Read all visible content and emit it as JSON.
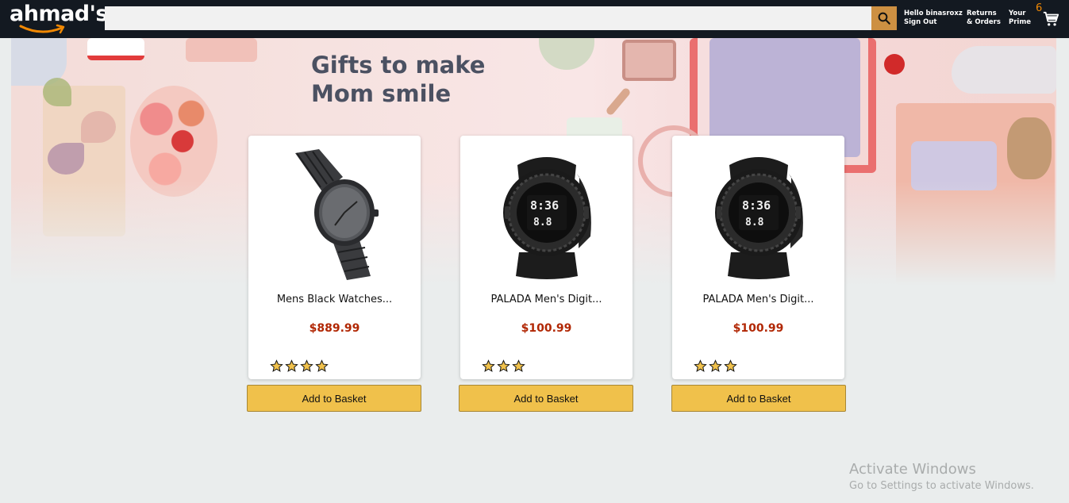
{
  "header": {
    "logo_text": "ahmad's",
    "search": {
      "value": "",
      "placeholder": ""
    },
    "greeting_line1": "Hello binasroxz",
    "greeting_line2": "Sign Out",
    "returns_line1": "Returns",
    "returns_line2": "& Orders",
    "prime_line1": "Your",
    "prime_line2": "Prime",
    "basket_count": "6",
    "icons": {
      "search": "search-icon",
      "cart": "cart-icon"
    },
    "colors": {
      "bar": "#131921",
      "search_button": "#cd9042",
      "basket_count": "#f08804"
    }
  },
  "hero": {
    "title_line1": "Gifts to make",
    "title_line2": "Mom smile"
  },
  "products": [
    {
      "title": "Mens Black Watches...",
      "price": "$889.99",
      "rating": 4,
      "button_label": "Add to Basket",
      "image": "black-analog-watch"
    },
    {
      "title": "PALADA Men's Digit...",
      "price": "$100.99",
      "rating": 3,
      "button_label": "Add to Basket",
      "image": "digital-sport-watch"
    },
    {
      "title": "PALADA Men's Digit...",
      "price": "$100.99",
      "rating": 3,
      "button_label": "Add to Basket",
      "image": "digital-sport-watch"
    }
  ],
  "colors": {
    "price": "#b12704",
    "button": "#f0c14b",
    "star": "#f0c14b",
    "page_bg": "#eaeded"
  },
  "watermark": {
    "line1": "Activate Windows",
    "line2": "Go to Settings to activate Windows."
  }
}
